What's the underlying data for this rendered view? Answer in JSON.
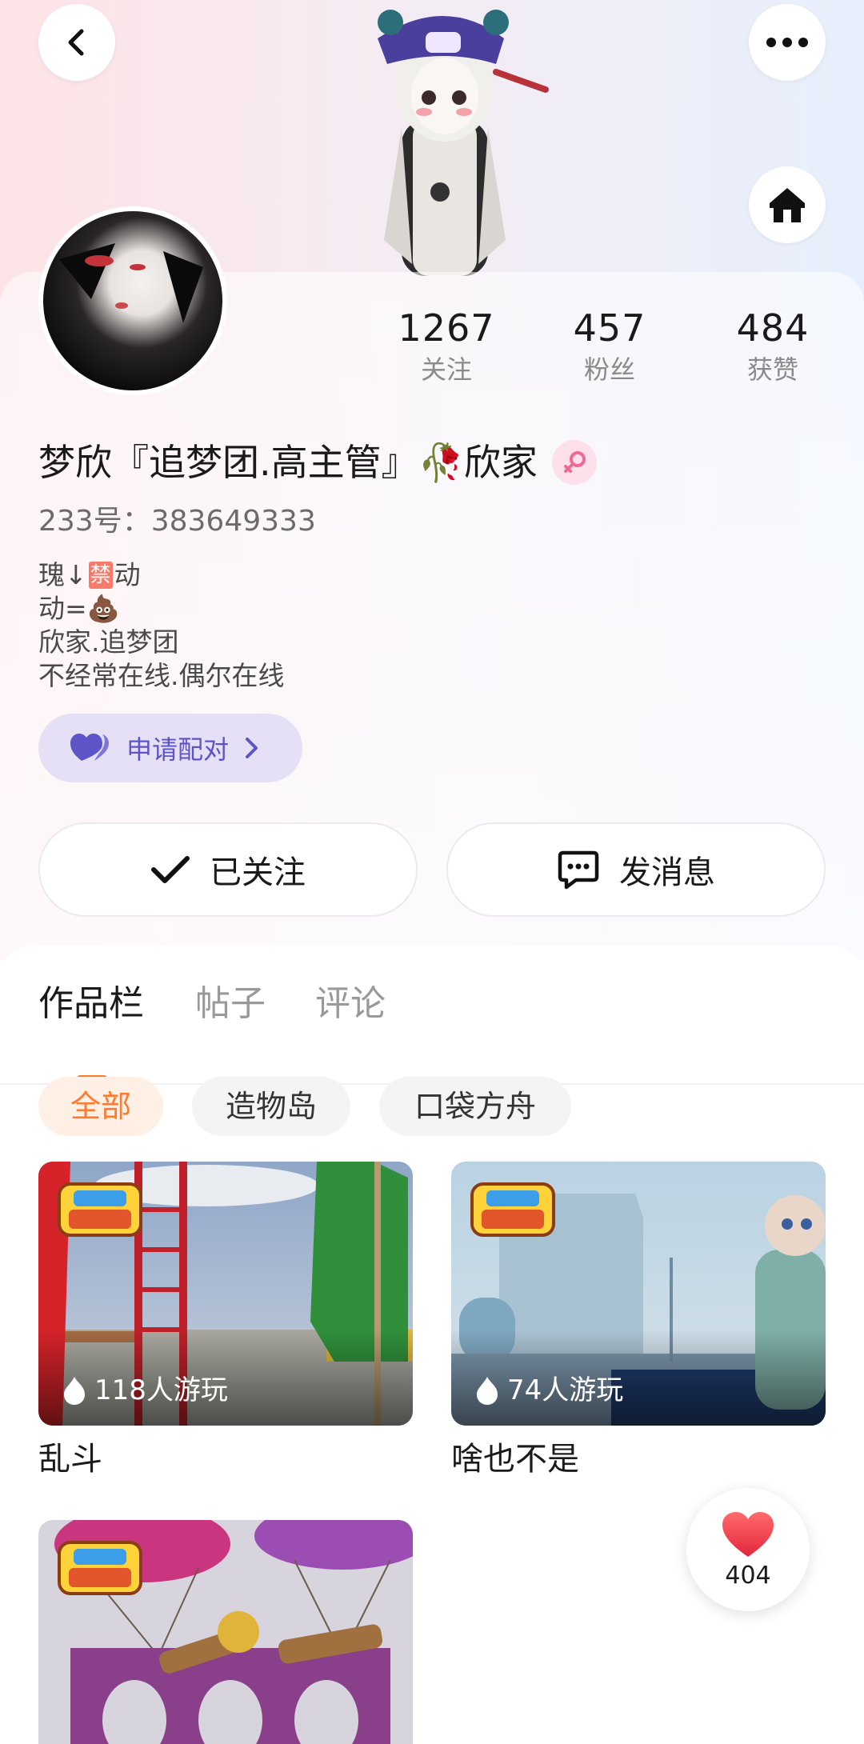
{
  "profile": {
    "name": "梦欣『追梦团.高主管』🥀欣家",
    "uid": "233号：383649333",
    "bio": [
      "瑰↓",
      "禁",
      "动",
      "动=💩",
      "欣家.追梦团",
      "不经常在线.偶尔在线"
    ]
  },
  "stats": [
    {
      "value": "1267",
      "label": "关注"
    },
    {
      "value": "457",
      "label": "粉丝"
    },
    {
      "value": "484",
      "label": "获赞"
    }
  ],
  "pair": {
    "label": "申请配对"
  },
  "actions": {
    "follow_label": "已关注",
    "message_label": "发消息"
  },
  "tabs": [
    "作品栏",
    "帖子",
    "评论"
  ],
  "filters": [
    "全部",
    "造物岛",
    "口袋方舟"
  ],
  "works": [
    {
      "title": "乱斗",
      "plays": "118人游玩",
      "badge": "233造物岛"
    },
    {
      "title": "啥也不是",
      "plays": "74人游玩",
      "badge": "233造物岛"
    },
    {
      "title": "",
      "plays": "",
      "badge": "233造物岛"
    }
  ],
  "like_fab": {
    "count": "404"
  },
  "colors": {
    "accent": "#ff7a2e",
    "pair_text": "#5d54c7",
    "pair_bg": "#e6e0f6"
  }
}
